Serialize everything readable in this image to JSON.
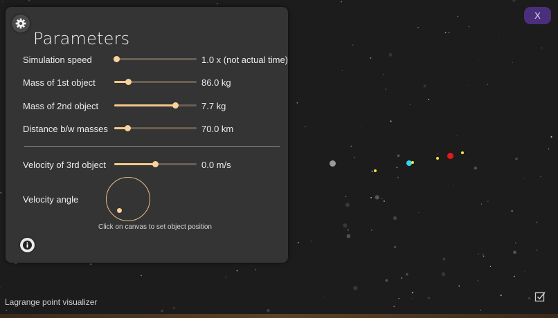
{
  "panel": {
    "title": "Parameters",
    "icons": {
      "settings": "gear-icon",
      "info": "info-icon"
    },
    "sliders": [
      {
        "id": "simulation-speed",
        "label": "Simulation speed",
        "value_text": "1.0 x (not actual time)",
        "level": 0.03
      },
      {
        "id": "mass-1",
        "label": "Mass of 1st object",
        "value_text": "86.0 kg",
        "level": 0.17
      },
      {
        "id": "mass-2",
        "label": "Mass of 2nd object",
        "value_text": "7.7 kg",
        "level": 0.74
      },
      {
        "id": "distance",
        "label": "Distance b/w masses",
        "value_text": "70.0 km",
        "level": 0.16
      },
      {
        "id": "velocity-3",
        "label": "Velocity of 3rd object",
        "value_text": "0.0 m/s",
        "level": 0.5
      }
    ],
    "velocity_angle_label": "Velocity angle",
    "hint": "Click on canvas to set object position"
  },
  "close_button_label": "X",
  "app_title": "Lagrange point visualizer",
  "colors": {
    "panel_bg": "#343434",
    "slider_accent": "#fbd39a",
    "close_button_bg": "#4a2f7c",
    "space_bg": "#1c1c1c"
  },
  "bodies": [
    {
      "name": "gray-body",
      "color": "#9a9a9a"
    },
    {
      "name": "cyan-body",
      "color": "#36d6ef"
    },
    {
      "name": "red-body",
      "color": "#e21a1a"
    },
    {
      "name": "lagrange-point",
      "color": "#f5e33b"
    }
  ]
}
